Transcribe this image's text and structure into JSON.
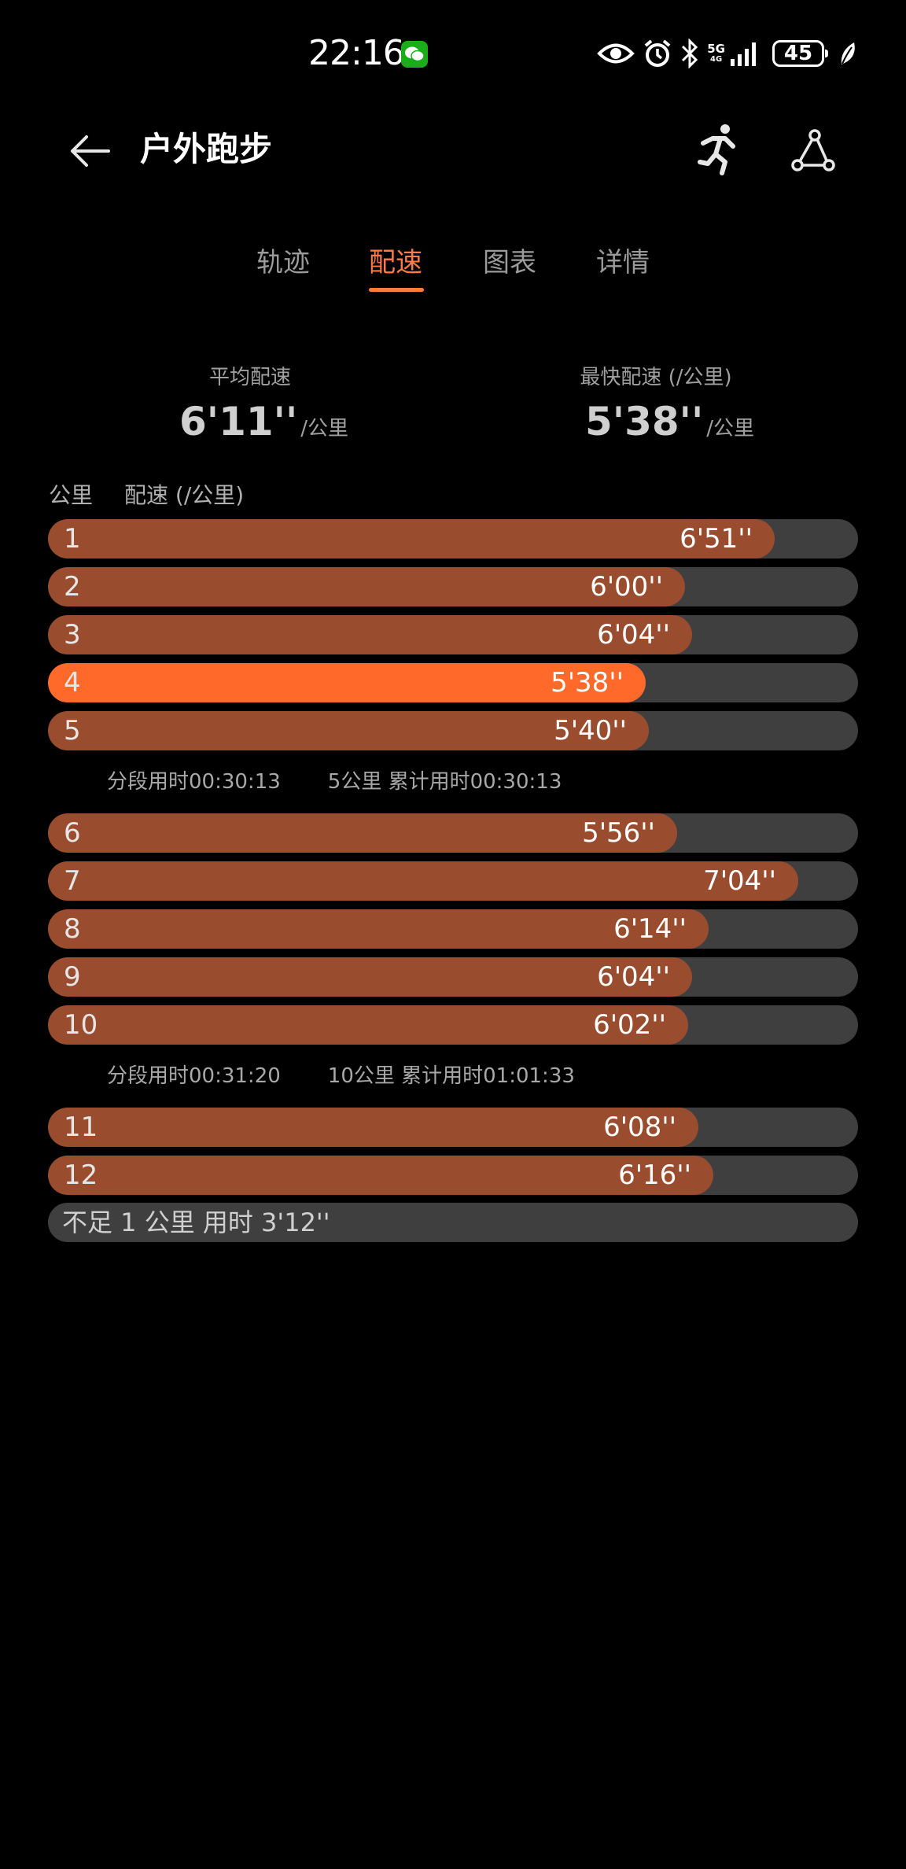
{
  "status_bar": {
    "time": "22:16",
    "network": "5G",
    "network_sub": "4G",
    "battery": "45"
  },
  "header": {
    "title": "户外跑步"
  },
  "tabs": [
    {
      "label": "轨迹"
    },
    {
      "label": "配速"
    },
    {
      "label": "图表"
    },
    {
      "label": "详情"
    }
  ],
  "active_tab": "配速",
  "summary": {
    "avg_label": "平均配速",
    "avg_value": "6'11''",
    "avg_unit": "/公里",
    "fast_label": "最快配速 (/公里)",
    "fast_value": "5'38''",
    "fast_unit": "/公里"
  },
  "table": {
    "col_km": "公里",
    "col_pace": "配速 (/公里)"
  },
  "laps": [
    {
      "km": "1",
      "pace": "6'51''",
      "fill": 0.897
    },
    {
      "km": "2",
      "pace": "6'00''",
      "fill": 0.786
    },
    {
      "km": "3",
      "pace": "6'04''",
      "fill": 0.795
    },
    {
      "km": "4",
      "pace": "5'38''",
      "fill": 0.738,
      "fastest": true
    },
    {
      "km": "5",
      "pace": "5'40''",
      "fill": 0.742
    },
    {
      "km": "6",
      "pace": "5'56''",
      "fill": 0.777
    },
    {
      "km": "7",
      "pace": "7'04''",
      "fill": 0.926
    },
    {
      "km": "8",
      "pace": "6'14''",
      "fill": 0.816
    },
    {
      "km": "9",
      "pace": "6'04''",
      "fill": 0.795
    },
    {
      "km": "10",
      "pace": "6'02''",
      "fill": 0.79
    },
    {
      "km": "11",
      "pace": "6'08''",
      "fill": 0.803
    },
    {
      "km": "12",
      "pace": "6'16''",
      "fill": 0.821
    }
  ],
  "splits": [
    {
      "segment": "分段用时00:30:13",
      "cumulative": "5公里 累计用时00:30:13"
    },
    {
      "segment": "分段用时00:31:20",
      "cumulative": "10公里 累计用时01:01:33"
    }
  ],
  "remainder": "不足 1 公里 用时 3'12''",
  "colors": {
    "accent": "#ff7a45",
    "bar_fill": "#9a4d2e",
    "bar_fastest": "#ff6a2b",
    "bar_track": "#3f3f3f"
  }
}
